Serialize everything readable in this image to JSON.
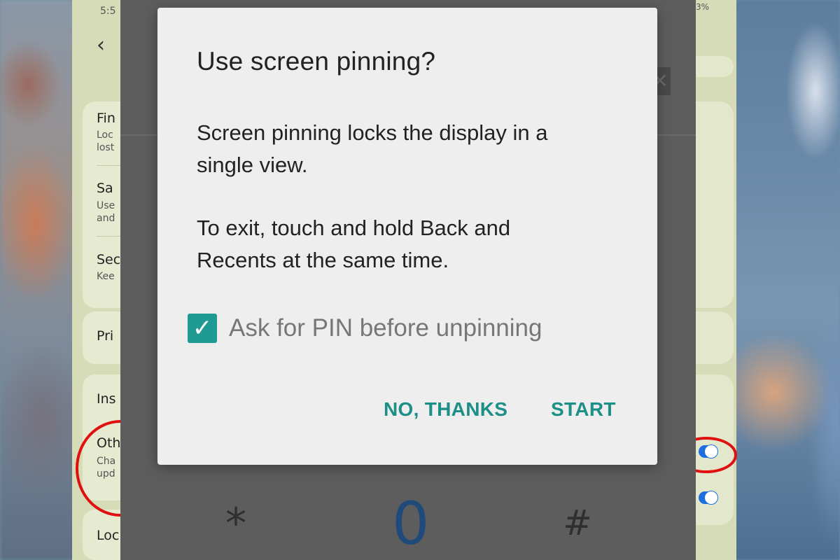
{
  "status_bar": {
    "time": "5:5",
    "battery": "3%"
  },
  "settings": {
    "back_icon": "back-arrow-icon",
    "rows": [
      {
        "title": "Fin",
        "sub1": "Loc",
        "sub2": "lost"
      },
      {
        "title": "Sa",
        "sub1": "Use",
        "sub2": "and"
      },
      {
        "title": "Sec",
        "sub1": "Kee"
      },
      {
        "title": "Pri"
      },
      {
        "title": "Ins"
      },
      {
        "title": "Oth",
        "sub1": "Cha",
        "sub2": "upd"
      },
      {
        "title": "Loc"
      }
    ]
  },
  "dialog": {
    "title": "Use screen pinning?",
    "body_1_line1": "Screen pinning locks the display in a",
    "body_1_line2": "single view.",
    "body_2_line1": "To exit, touch and hold Back and",
    "body_2_line2": "Recents at the same time.",
    "checkbox_label": "Ask for PIN before unpinning",
    "checkbox_checked": true,
    "no_button": "NO, THANKS",
    "start_button": "START"
  },
  "dialpad": {
    "star": "*",
    "zero": "0",
    "hash": "#"
  },
  "colors": {
    "accent": "#1c8f86",
    "toggle": "#1d6fe0",
    "highlight": "#e01010"
  }
}
